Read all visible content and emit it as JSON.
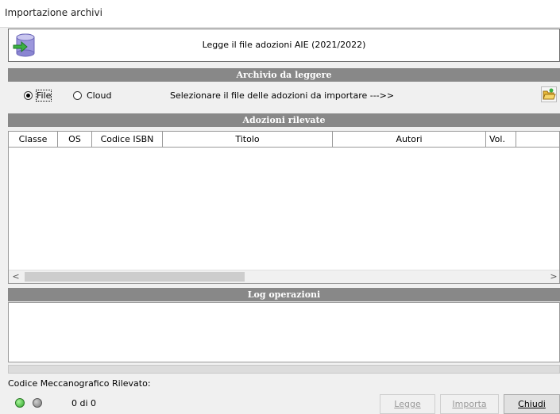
{
  "window": {
    "title": "Importazione archivi"
  },
  "header": {
    "description": "Legge il file adozioni AIE (2021/2022)",
    "icon": "database-import-icon"
  },
  "sections": {
    "archivio": "Archivio da leggere",
    "adozioni": "Adozioni rilevate",
    "log": "Log operazioni"
  },
  "source": {
    "options": [
      {
        "label": "File",
        "selected": true
      },
      {
        "label": "Cloud",
        "selected": false
      }
    ],
    "prompt": "Selezionare il file delle adozioni da importare --->>",
    "browse_icon": "folder-open-icon"
  },
  "table": {
    "columns": [
      "Classe",
      "OS",
      "Codice ISBN",
      "Titolo",
      "Autori",
      "Vol.",
      ""
    ],
    "rows": []
  },
  "scrollbar": {
    "left": "<",
    "right": ">"
  },
  "footer": {
    "codice_label": "Codice Meccanografico Rilevato:",
    "counter": "0 di 0",
    "status_colors": {
      "ok": "#2fa52a",
      "idle": "#777777"
    }
  },
  "buttons": {
    "legge": {
      "label": "Legge",
      "enabled": false
    },
    "importa": {
      "label": "Importa",
      "enabled": false
    },
    "chiudi": {
      "label": "Chiudi",
      "enabled": true
    }
  },
  "colors": {
    "section_bar": "#888888",
    "background": "#f0f0f0"
  }
}
